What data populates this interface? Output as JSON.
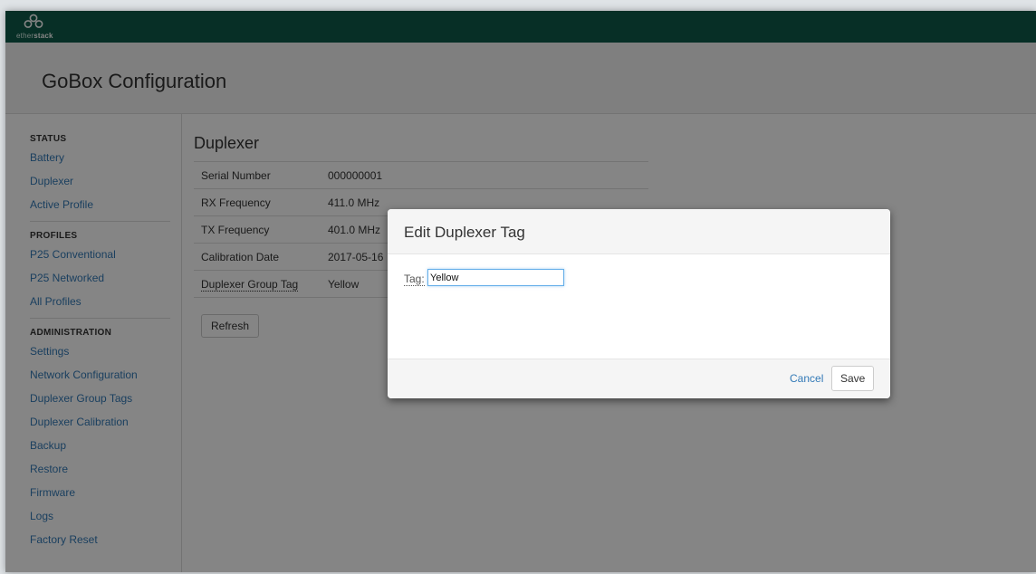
{
  "brand": {
    "logo_prefix": "ether",
    "logo_suffix": "stack"
  },
  "header": {
    "title": "GoBox Configuration"
  },
  "sidebar": {
    "sections": [
      {
        "title": "STATUS",
        "items": [
          "Battery",
          "Duplexer",
          "Active Profile"
        ]
      },
      {
        "title": "PROFILES",
        "items": [
          "P25 Conventional",
          "P25 Networked",
          "All Profiles"
        ]
      },
      {
        "title": "ADMINISTRATION",
        "items": [
          "Settings",
          "Network Configuration",
          "Duplexer Group Tags",
          "Duplexer Calibration",
          "Backup",
          "Restore",
          "Firmware",
          "Logs",
          "Factory Reset"
        ]
      }
    ]
  },
  "main": {
    "title": "Duplexer",
    "rows": [
      {
        "label": "Serial Number",
        "value": "000000001"
      },
      {
        "label": "RX Frequency",
        "value": "411.0 MHz"
      },
      {
        "label": "TX Frequency",
        "value": "401.0 MHz"
      },
      {
        "label": "Calibration Date",
        "value": "2017-05-16"
      },
      {
        "label": "Duplexer Group Tag",
        "value": "Yellow"
      }
    ],
    "refresh_label": "Refresh"
  },
  "modal": {
    "title": "Edit Duplexer Tag",
    "tag_label": "Tag:",
    "tag_value": "Yellow",
    "cancel_label": "Cancel",
    "save_label": "Save"
  },
  "colors": {
    "brand_bar": "#0f5a49",
    "link": "#337ab7"
  },
  "icons": {
    "logo": "etherstack-logo-icon"
  }
}
